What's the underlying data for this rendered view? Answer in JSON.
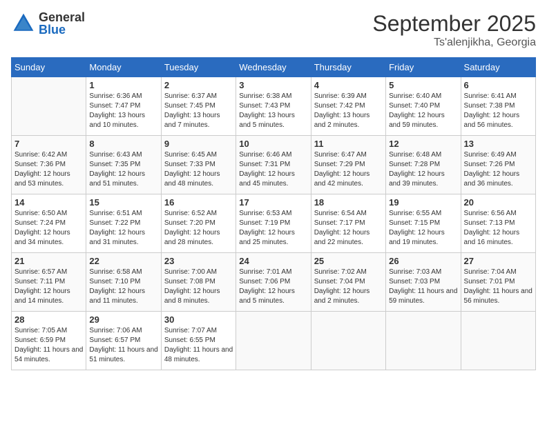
{
  "logo": {
    "general": "General",
    "blue": "Blue"
  },
  "header": {
    "month": "September 2025",
    "location": "Ts'alenjikha, Georgia"
  },
  "days_of_week": [
    "Sunday",
    "Monday",
    "Tuesday",
    "Wednesday",
    "Thursday",
    "Friday",
    "Saturday"
  ],
  "weeks": [
    [
      {
        "day": "",
        "sunrise": "",
        "sunset": "",
        "daylight": ""
      },
      {
        "day": "1",
        "sunrise": "Sunrise: 6:36 AM",
        "sunset": "Sunset: 7:47 PM",
        "daylight": "Daylight: 13 hours and 10 minutes."
      },
      {
        "day": "2",
        "sunrise": "Sunrise: 6:37 AM",
        "sunset": "Sunset: 7:45 PM",
        "daylight": "Daylight: 13 hours and 7 minutes."
      },
      {
        "day": "3",
        "sunrise": "Sunrise: 6:38 AM",
        "sunset": "Sunset: 7:43 PM",
        "daylight": "Daylight: 13 hours and 5 minutes."
      },
      {
        "day": "4",
        "sunrise": "Sunrise: 6:39 AM",
        "sunset": "Sunset: 7:42 PM",
        "daylight": "Daylight: 13 hours and 2 minutes."
      },
      {
        "day": "5",
        "sunrise": "Sunrise: 6:40 AM",
        "sunset": "Sunset: 7:40 PM",
        "daylight": "Daylight: 12 hours and 59 minutes."
      },
      {
        "day": "6",
        "sunrise": "Sunrise: 6:41 AM",
        "sunset": "Sunset: 7:38 PM",
        "daylight": "Daylight: 12 hours and 56 minutes."
      }
    ],
    [
      {
        "day": "7",
        "sunrise": "Sunrise: 6:42 AM",
        "sunset": "Sunset: 7:36 PM",
        "daylight": "Daylight: 12 hours and 53 minutes."
      },
      {
        "day": "8",
        "sunrise": "Sunrise: 6:43 AM",
        "sunset": "Sunset: 7:35 PM",
        "daylight": "Daylight: 12 hours and 51 minutes."
      },
      {
        "day": "9",
        "sunrise": "Sunrise: 6:45 AM",
        "sunset": "Sunset: 7:33 PM",
        "daylight": "Daylight: 12 hours and 48 minutes."
      },
      {
        "day": "10",
        "sunrise": "Sunrise: 6:46 AM",
        "sunset": "Sunset: 7:31 PM",
        "daylight": "Daylight: 12 hours and 45 minutes."
      },
      {
        "day": "11",
        "sunrise": "Sunrise: 6:47 AM",
        "sunset": "Sunset: 7:29 PM",
        "daylight": "Daylight: 12 hours and 42 minutes."
      },
      {
        "day": "12",
        "sunrise": "Sunrise: 6:48 AM",
        "sunset": "Sunset: 7:28 PM",
        "daylight": "Daylight: 12 hours and 39 minutes."
      },
      {
        "day": "13",
        "sunrise": "Sunrise: 6:49 AM",
        "sunset": "Sunset: 7:26 PM",
        "daylight": "Daylight: 12 hours and 36 minutes."
      }
    ],
    [
      {
        "day": "14",
        "sunrise": "Sunrise: 6:50 AM",
        "sunset": "Sunset: 7:24 PM",
        "daylight": "Daylight: 12 hours and 34 minutes."
      },
      {
        "day": "15",
        "sunrise": "Sunrise: 6:51 AM",
        "sunset": "Sunset: 7:22 PM",
        "daylight": "Daylight: 12 hours and 31 minutes."
      },
      {
        "day": "16",
        "sunrise": "Sunrise: 6:52 AM",
        "sunset": "Sunset: 7:20 PM",
        "daylight": "Daylight: 12 hours and 28 minutes."
      },
      {
        "day": "17",
        "sunrise": "Sunrise: 6:53 AM",
        "sunset": "Sunset: 7:19 PM",
        "daylight": "Daylight: 12 hours and 25 minutes."
      },
      {
        "day": "18",
        "sunrise": "Sunrise: 6:54 AM",
        "sunset": "Sunset: 7:17 PM",
        "daylight": "Daylight: 12 hours and 22 minutes."
      },
      {
        "day": "19",
        "sunrise": "Sunrise: 6:55 AM",
        "sunset": "Sunset: 7:15 PM",
        "daylight": "Daylight: 12 hours and 19 minutes."
      },
      {
        "day": "20",
        "sunrise": "Sunrise: 6:56 AM",
        "sunset": "Sunset: 7:13 PM",
        "daylight": "Daylight: 12 hours and 16 minutes."
      }
    ],
    [
      {
        "day": "21",
        "sunrise": "Sunrise: 6:57 AM",
        "sunset": "Sunset: 7:11 PM",
        "daylight": "Daylight: 12 hours and 14 minutes."
      },
      {
        "day": "22",
        "sunrise": "Sunrise: 6:58 AM",
        "sunset": "Sunset: 7:10 PM",
        "daylight": "Daylight: 12 hours and 11 minutes."
      },
      {
        "day": "23",
        "sunrise": "Sunrise: 7:00 AM",
        "sunset": "Sunset: 7:08 PM",
        "daylight": "Daylight: 12 hours and 8 minutes."
      },
      {
        "day": "24",
        "sunrise": "Sunrise: 7:01 AM",
        "sunset": "Sunset: 7:06 PM",
        "daylight": "Daylight: 12 hours and 5 minutes."
      },
      {
        "day": "25",
        "sunrise": "Sunrise: 7:02 AM",
        "sunset": "Sunset: 7:04 PM",
        "daylight": "Daylight: 12 hours and 2 minutes."
      },
      {
        "day": "26",
        "sunrise": "Sunrise: 7:03 AM",
        "sunset": "Sunset: 7:03 PM",
        "daylight": "Daylight: 11 hours and 59 minutes."
      },
      {
        "day": "27",
        "sunrise": "Sunrise: 7:04 AM",
        "sunset": "Sunset: 7:01 PM",
        "daylight": "Daylight: 11 hours and 56 minutes."
      }
    ],
    [
      {
        "day": "28",
        "sunrise": "Sunrise: 7:05 AM",
        "sunset": "Sunset: 6:59 PM",
        "daylight": "Daylight: 11 hours and 54 minutes."
      },
      {
        "day": "29",
        "sunrise": "Sunrise: 7:06 AM",
        "sunset": "Sunset: 6:57 PM",
        "daylight": "Daylight: 11 hours and 51 minutes."
      },
      {
        "day": "30",
        "sunrise": "Sunrise: 7:07 AM",
        "sunset": "Sunset: 6:55 PM",
        "daylight": "Daylight: 11 hours and 48 minutes."
      },
      {
        "day": "",
        "sunrise": "",
        "sunset": "",
        "daylight": ""
      },
      {
        "day": "",
        "sunrise": "",
        "sunset": "",
        "daylight": ""
      },
      {
        "day": "",
        "sunrise": "",
        "sunset": "",
        "daylight": ""
      },
      {
        "day": "",
        "sunrise": "",
        "sunset": "",
        "daylight": ""
      }
    ]
  ]
}
